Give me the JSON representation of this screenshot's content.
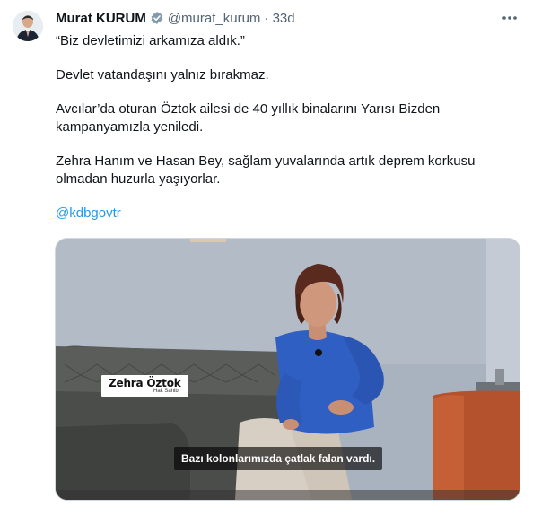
{
  "tweet": {
    "author_name": "Murat KURUM",
    "handle": "@murat_kurum",
    "time": "· 33d",
    "paragraphs": [
      "“Biz devletimizi arkamıza aldık.”",
      "Devlet vatandaşını yalnız bırakmaz.",
      "Avcılar’da oturan Öztok ailesi de 40 yıllık binalarını Yarısı Bizden kampanyamızla yeniledi.",
      "Zehra Hanım ve Hasan Bey, sağlam yuvalarında artık deprem korkusu olmadan huzurla yaşıyorlar."
    ],
    "mention": "@kdbgovtr"
  },
  "video": {
    "name_tag": "Zehra Öztok",
    "name_tag_role": "Hak Sahibi",
    "subtitle": "Bazı kolonlarımızda çatlak falan vardı."
  },
  "icons": {
    "verified": "verified-badge-icon",
    "more": "more-options-icon"
  },
  "colors": {
    "link": "#1d9bf0",
    "verified": "#829aab",
    "text": "#0f1419",
    "secondary": "#536471"
  }
}
